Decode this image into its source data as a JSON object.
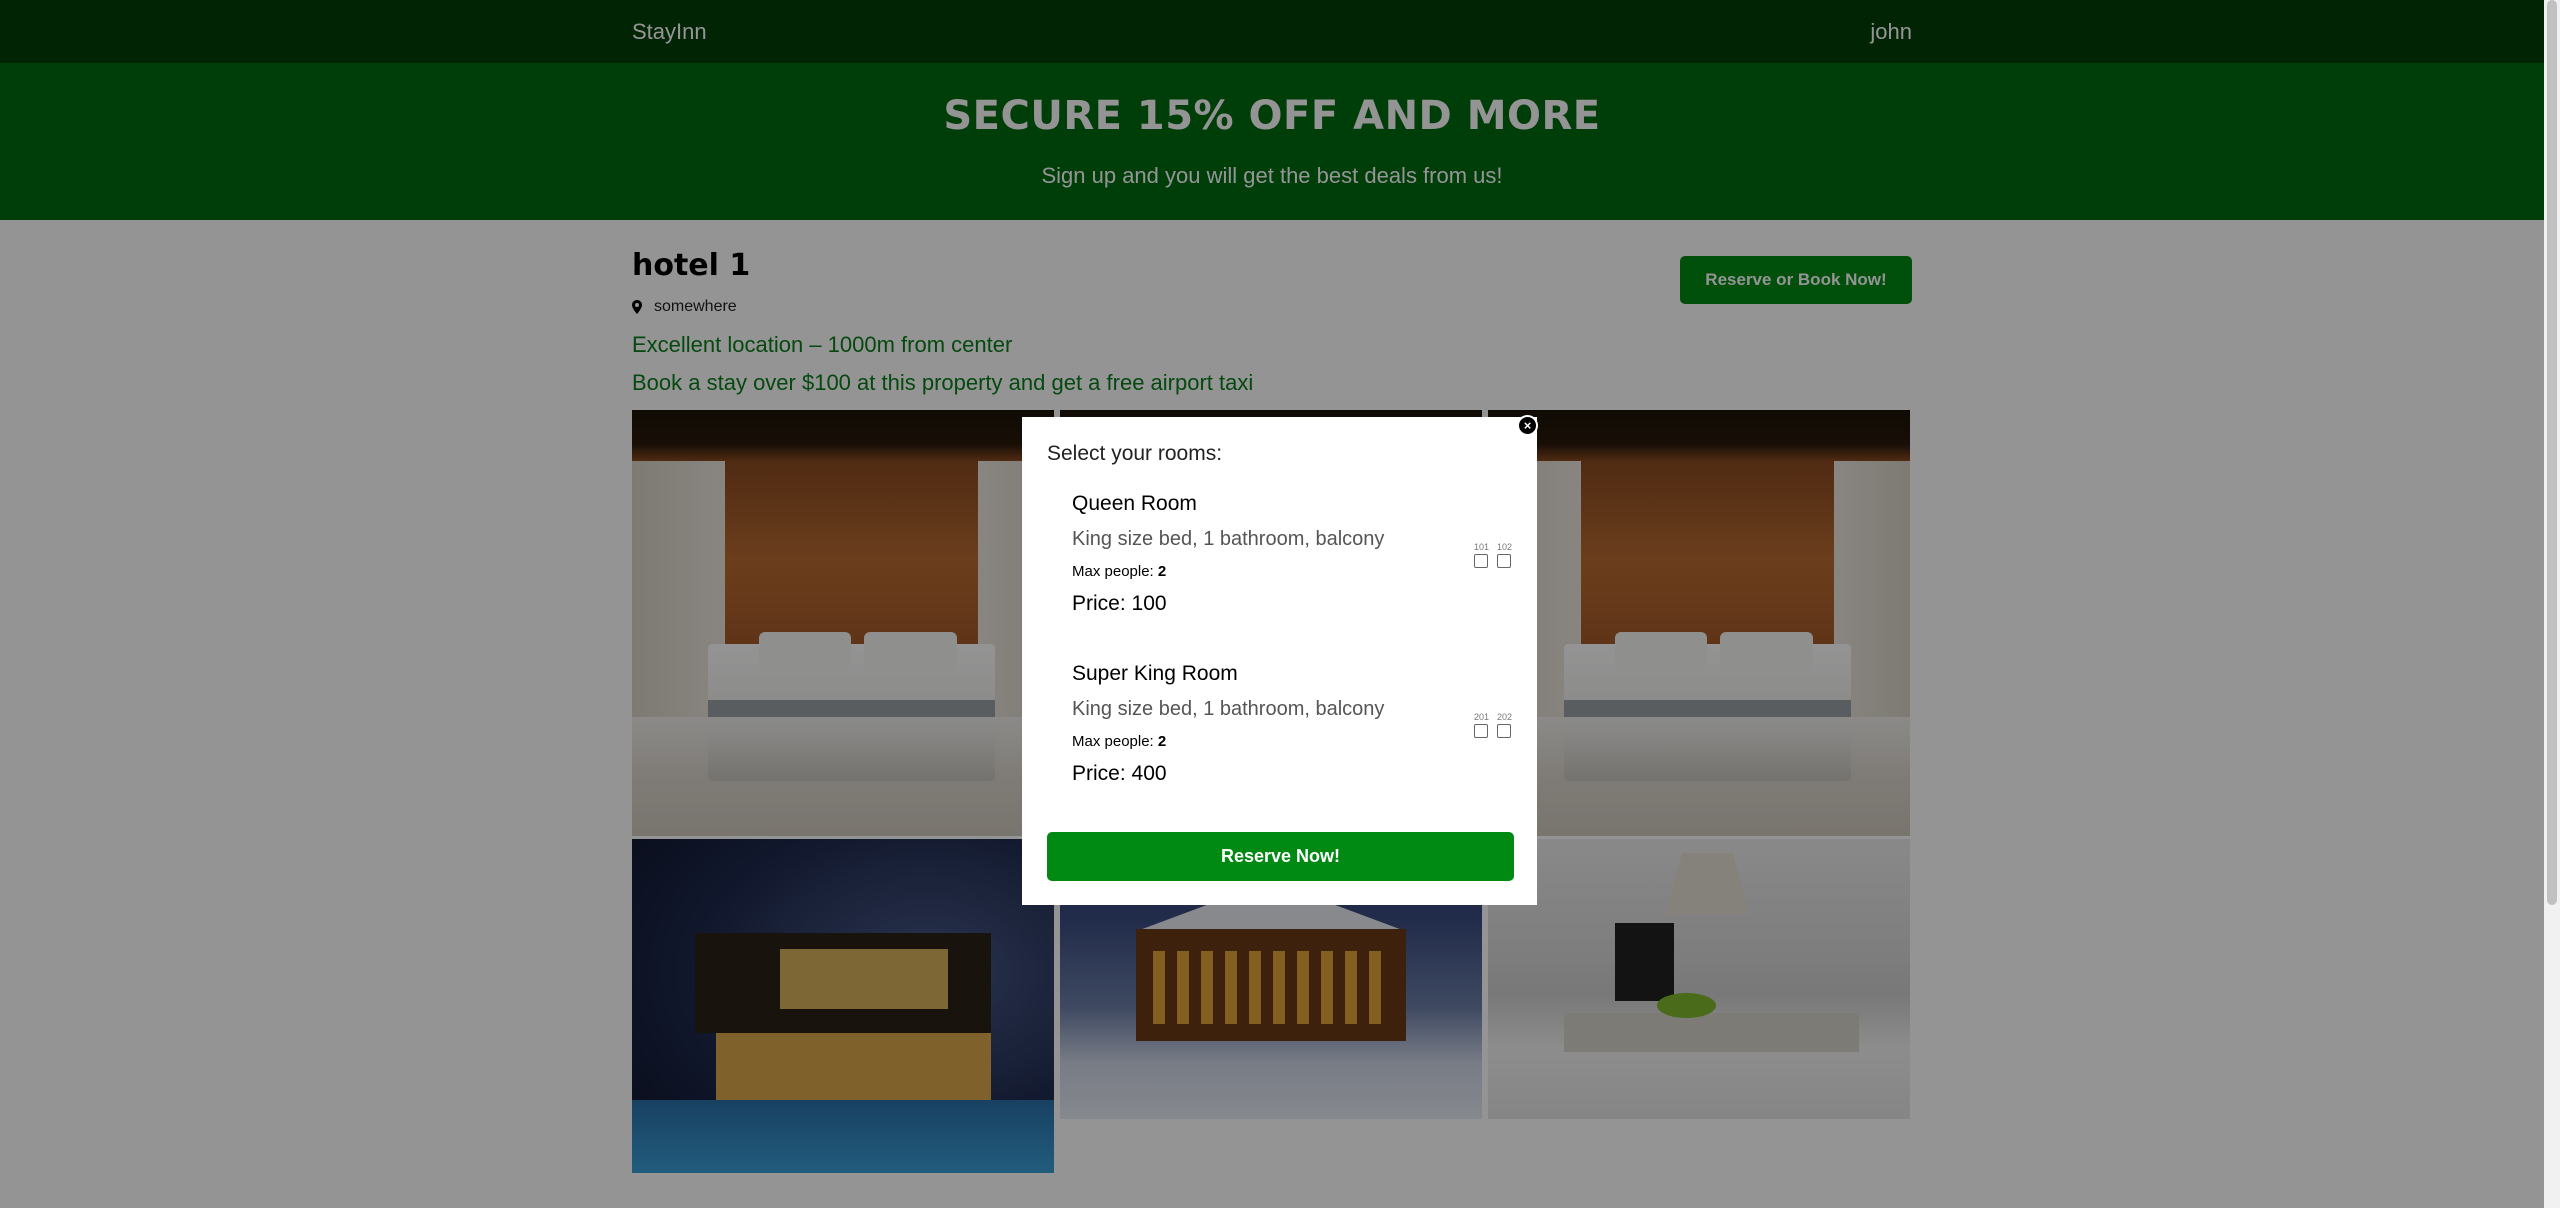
{
  "nav": {
    "logo": "StayInn",
    "user": "john"
  },
  "header": {
    "title": "SECURE 15% OFF AND MORE",
    "subtitle": "Sign up and you will get the best deals from us!"
  },
  "hotel": {
    "name": "hotel 1",
    "address": "somewhere",
    "location_text": "Excellent location – 1000m from center",
    "deal_text": "Book a stay over $100 at this property and get a free airport taxi",
    "book_button": "Reserve or Book Now!"
  },
  "modal": {
    "title": "Select your rooms:",
    "close_label": "×",
    "rooms": [
      {
        "title": "Queen Room",
        "desc": "King size bed, 1 bathroom, balcony",
        "max_label": "Max people:",
        "max_people": "2",
        "price": "Price: 100",
        "numbers": [
          "101",
          "102"
        ]
      },
      {
        "title": "Super King Room",
        "desc": "King size bed, 1 bathroom, balcony",
        "max_label": "Max people:",
        "max_people": "2",
        "price": "Price: 400",
        "numbers": [
          "201",
          "202"
        ]
      }
    ],
    "reserve_button": "Reserve Now!"
  },
  "colors": {
    "nav_bg": "#003e08",
    "header_bg": "#006b10",
    "accent_button": "#008a13",
    "text_green": "#0a7f1c"
  },
  "icons": {
    "location": "location-pin-icon",
    "close": "close-icon"
  }
}
